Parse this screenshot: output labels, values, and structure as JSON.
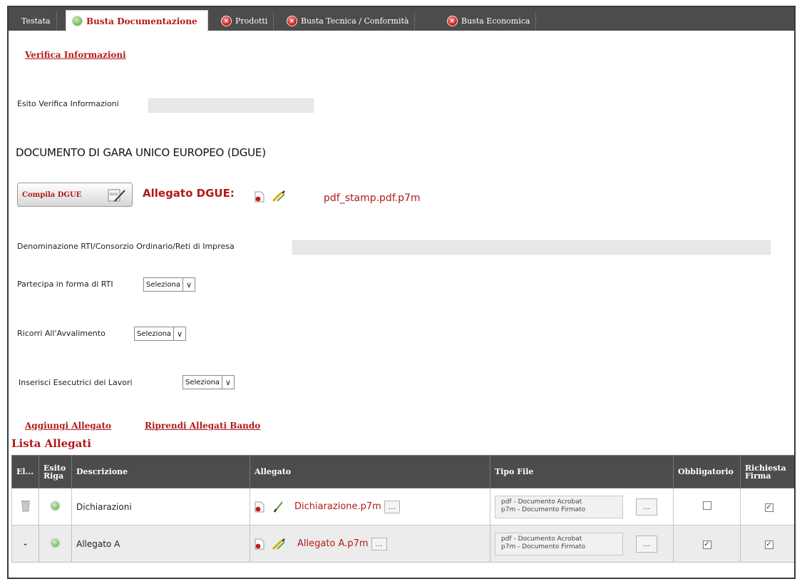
{
  "tabs": [
    {
      "label": "Testata",
      "icon": "",
      "active": false
    },
    {
      "label": "Busta Documentazione",
      "icon": "check-ok-icon",
      "active": true
    },
    {
      "label": "Prodotti",
      "icon": "error-icon",
      "active": false
    },
    {
      "label": "Busta Tecnica / Conformità",
      "icon": "error-icon",
      "active": false
    },
    {
      "label": "Busta Economica",
      "icon": "error-icon",
      "active": false
    }
  ],
  "verifica": {
    "link": "Verifica Informazioni",
    "esito_label": "Esito Verifica Informazioni",
    "esito_value": ""
  },
  "dgue": {
    "title": "DOCUMENTO DI GARA UNICO EUROPEO (DGUE)",
    "button_label": "Compila DGUE",
    "button_icon_text": "DGUE",
    "allegato_label": "Allegato DGUE:",
    "allegato_file": "pdf_stamp.pdf.p7m"
  },
  "form": {
    "denominazione_label": "Denominazione RTI/Consorzio Ordinario/Reti di Impresa",
    "denominazione_value": "",
    "rti_label": "Partecipa in forma di RTI",
    "rti_value": "Seleziona",
    "avvalimento_label": "Ricorri All'Avvalimento",
    "avvalimento_value": "Seleziona",
    "esecutrici_label": "Inserisci Esecutrici dei Lavori",
    "esecutrici_value": "Seleziona"
  },
  "actions": {
    "aggiungi": "Aggiungi Allegato",
    "riprendi": "Riprendi Allegati Bando"
  },
  "lista": {
    "title": "Lista Allegati",
    "columns": [
      "El...",
      "Esito Riga",
      "Descrizione",
      "Allegato",
      "Tipo File",
      "Obbligatorio",
      "Richiesta Firma"
    ],
    "rows": [
      {
        "el": "trash-icon",
        "esito": "check-ok-icon",
        "descrizione": "Dichiarazioni",
        "allegato": "Dichiarazione.p7m",
        "tipo_line1": "pdf - Documento Acrobat",
        "tipo_line2": "p7m - Documento Firmato",
        "obbligatorio": false,
        "firma": true
      },
      {
        "el": "-",
        "esito": "check-ok-icon",
        "descrizione": "Allegato A",
        "allegato": "Allegato A.p7m",
        "tipo_line1": "pdf - Documento Acrobat",
        "tipo_line2": "p7m - Documento Firmato",
        "obbligatorio": true,
        "firma": true
      }
    ]
  },
  "dots_label": "...",
  "colors": {
    "accent": "#b11a1a",
    "tabbar": "#4c4c4c",
    "ok": "#72bd58",
    "error": "#c51515"
  }
}
